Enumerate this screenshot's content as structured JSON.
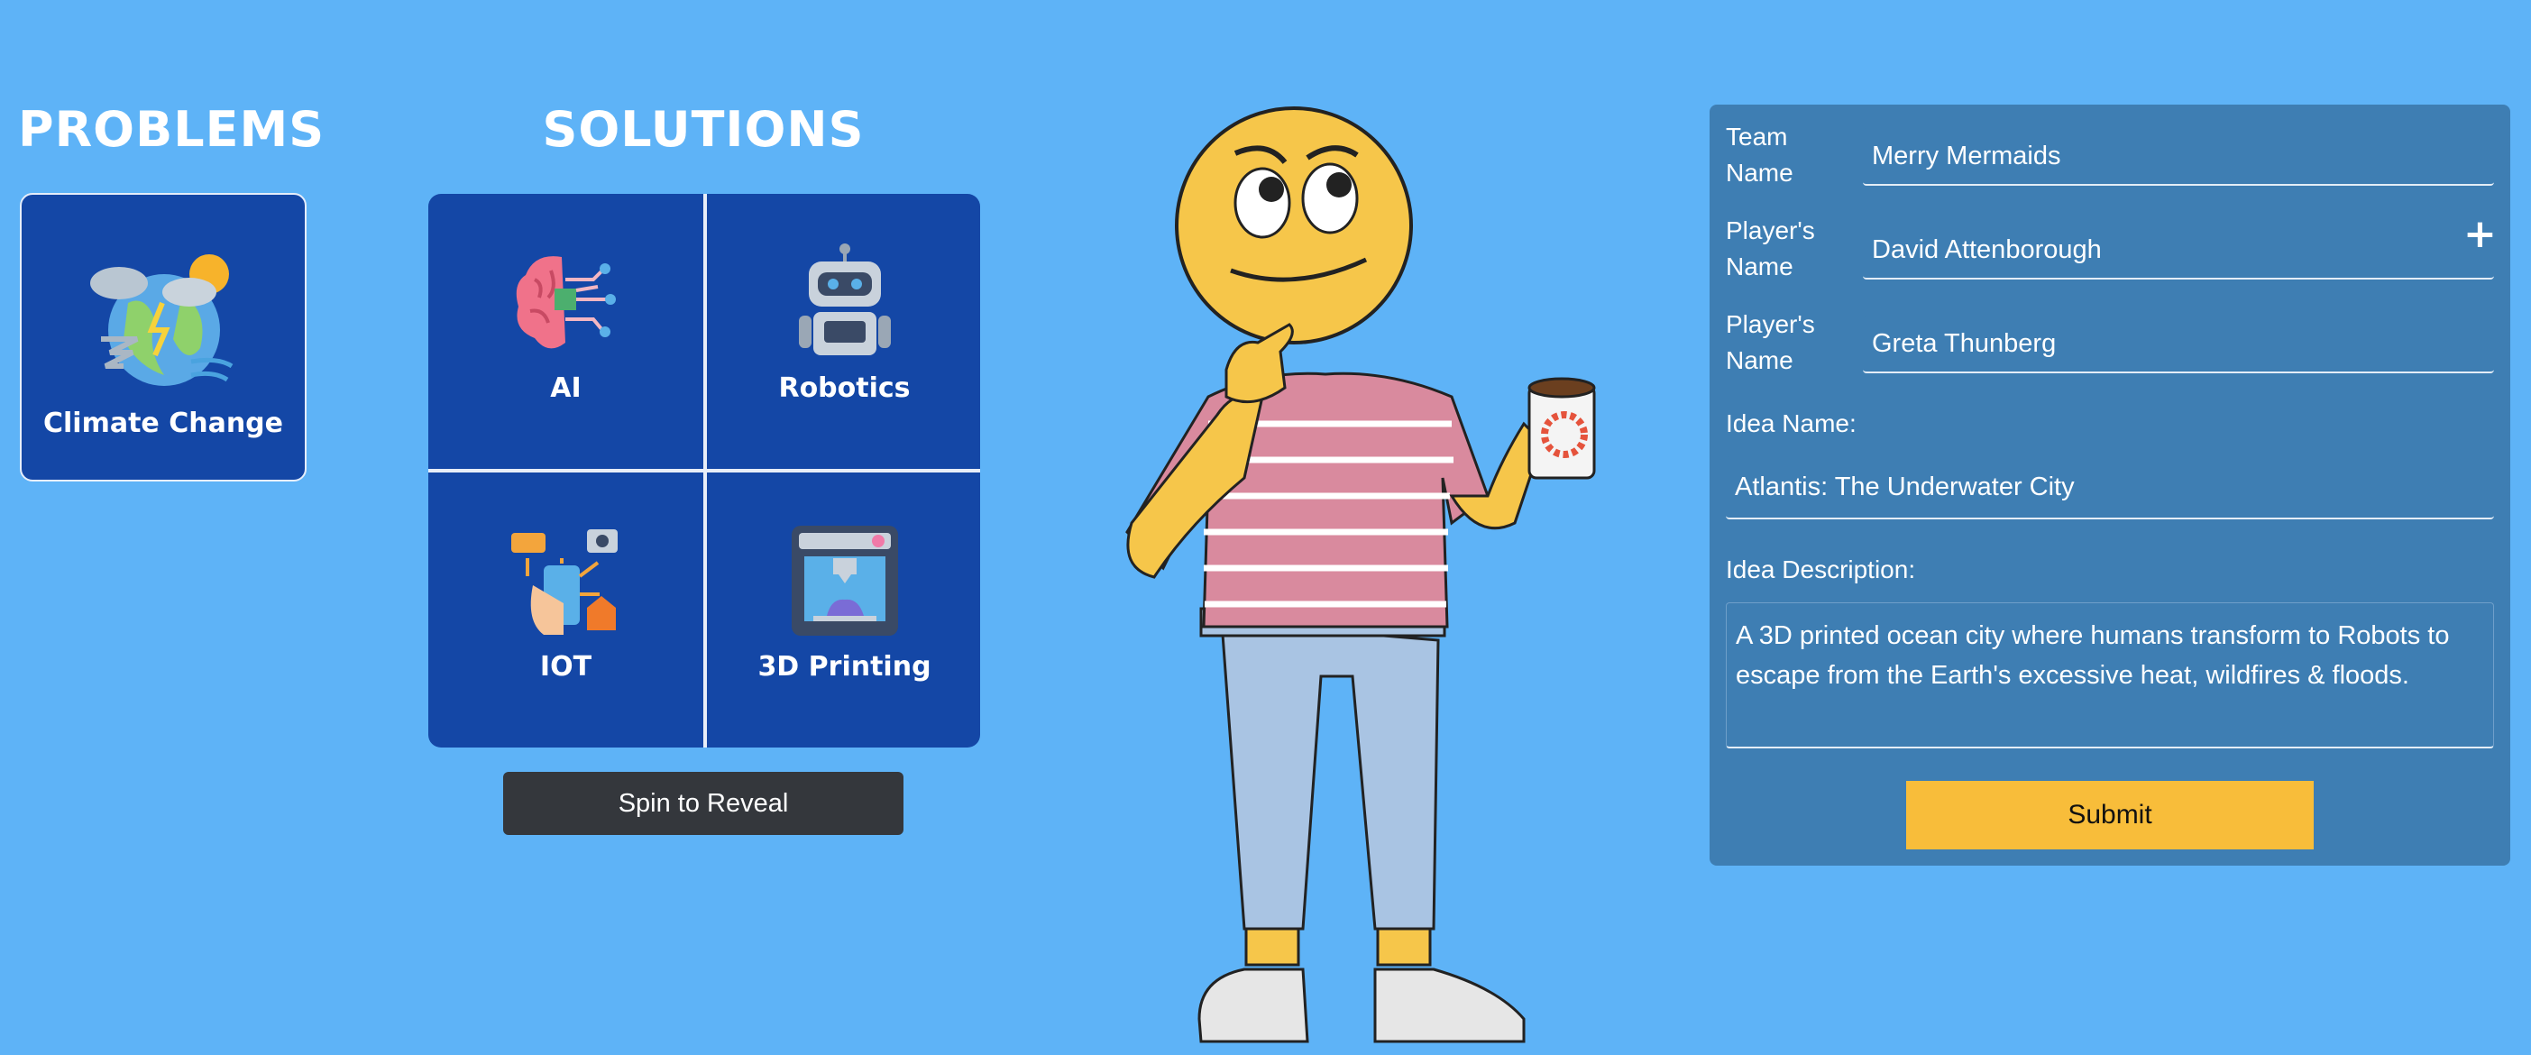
{
  "problems": {
    "heading": "PROBLEMS",
    "items": [
      {
        "label": "Climate Change",
        "icon": "climate-change-icon"
      }
    ]
  },
  "solutions": {
    "heading": "SOLUTIONS",
    "items": [
      {
        "label": "AI",
        "icon": "brain-circuit-icon"
      },
      {
        "label": "Robotics",
        "icon": "robot-icon"
      },
      {
        "label": "IOT",
        "icon": "iot-devices-icon"
      },
      {
        "label": "3D Printing",
        "icon": "3d-printer-icon"
      }
    ],
    "spin_label": "Spin to Reveal"
  },
  "form": {
    "team_label": "Team\nName",
    "team_value": "Merry Mermaids",
    "player1_label": "Player's\nName",
    "player1_value": "David Attenborough",
    "add_player_symbol": "+",
    "player2_label": "Player's\nName",
    "player2_value": "Greta Thunberg",
    "idea_name_label": "Idea Name:",
    "idea_name_value": "Atlantis: The Underwater City",
    "idea_desc_label": "Idea Description:",
    "idea_desc_value": "A 3D printed ocean city where humans transform to Robots to escape from the Earth's excessive heat, wildfires & floods.",
    "submit_label": "Submit"
  },
  "colors": {
    "background": "#5eb3f7",
    "card": "#1447a6",
    "panel": "#3e7eb3",
    "spin_button": "#34373c",
    "submit_button": "#f8bd3a"
  }
}
